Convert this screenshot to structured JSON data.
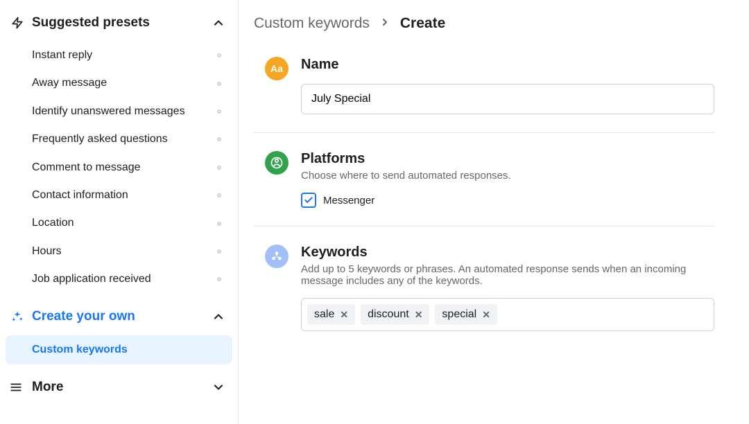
{
  "sidebar": {
    "suggested": {
      "title": "Suggested presets",
      "items": [
        {
          "label": "Instant reply"
        },
        {
          "label": "Away message"
        },
        {
          "label": "Identify unanswered messages"
        },
        {
          "label": "Frequently asked questions"
        },
        {
          "label": "Comment to message"
        },
        {
          "label": "Contact information"
        },
        {
          "label": "Location"
        },
        {
          "label": "Hours"
        },
        {
          "label": "Job application received"
        }
      ]
    },
    "create_own": {
      "title": "Create your own",
      "items": [
        {
          "label": "Custom keywords"
        }
      ]
    },
    "more": {
      "title": "More"
    }
  },
  "breadcrumb": {
    "parent": "Custom keywords",
    "current": "Create"
  },
  "form": {
    "name": {
      "heading": "Name",
      "value": "July Special"
    },
    "platforms": {
      "heading": "Platforms",
      "desc": "Choose where to send automated responses.",
      "options": [
        {
          "label": "Messenger",
          "checked": true
        }
      ]
    },
    "keywords": {
      "heading": "Keywords",
      "desc": "Add up to 5 keywords or phrases. An automated response sends when an incoming message includes any of the keywords.",
      "tags": [
        "sale",
        "discount",
        "special"
      ]
    }
  }
}
